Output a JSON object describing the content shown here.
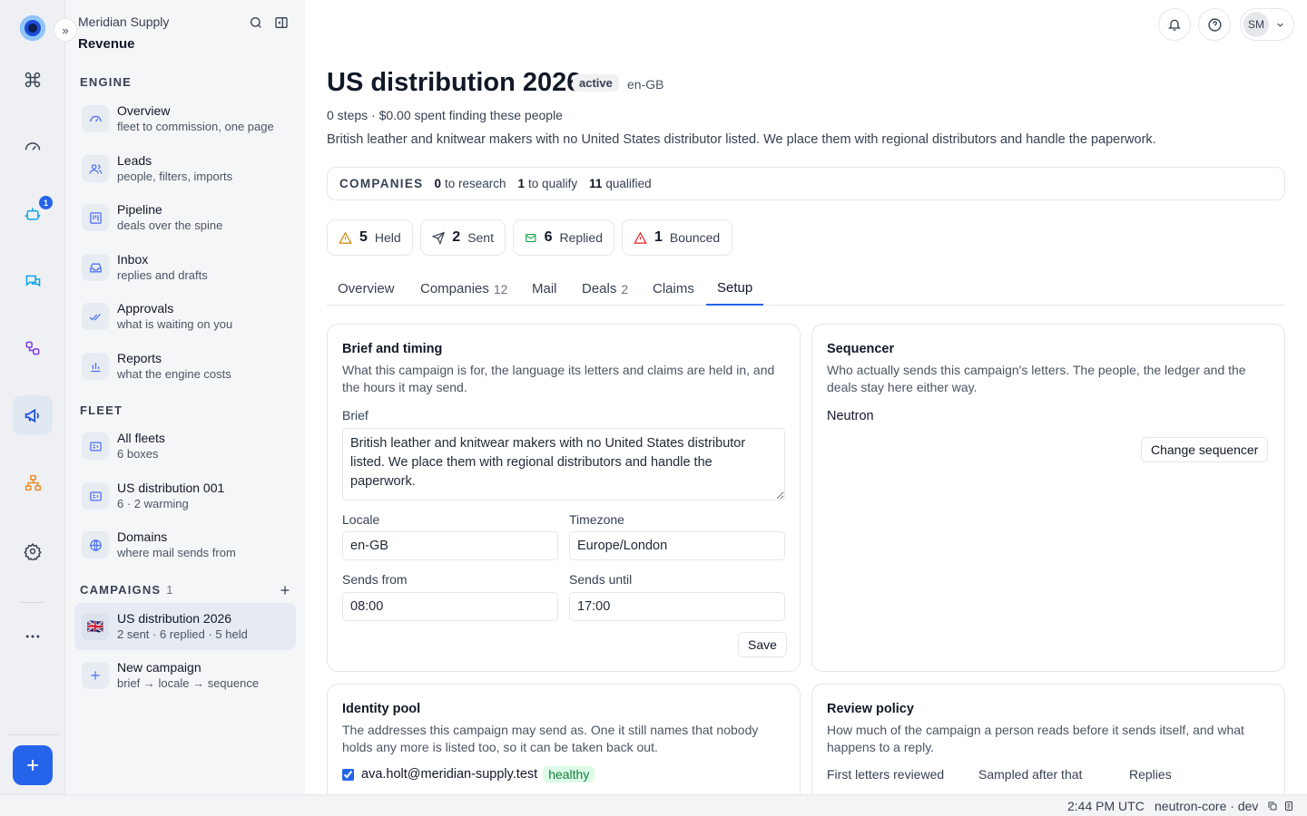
{
  "org": {
    "name": "Meridian Supply",
    "section": "Revenue"
  },
  "rail": {
    "badge_count": "1"
  },
  "sidebar": {
    "engine_title": "ENGINE",
    "engine": [
      {
        "label": "Overview",
        "sub": "fleet to commission, one page"
      },
      {
        "label": "Leads",
        "sub": "people, filters, imports"
      },
      {
        "label": "Pipeline",
        "sub": "deals over the spine"
      },
      {
        "label": "Inbox",
        "sub": "replies and drafts"
      },
      {
        "label": "Approvals",
        "sub": "what is waiting on you"
      },
      {
        "label": "Reports",
        "sub": "what the engine costs"
      }
    ],
    "fleet_title": "FLEET",
    "fleet": [
      {
        "label": "All fleets",
        "sub": "6 boxes"
      },
      {
        "label": "US distribution 001",
        "sub": "6 · 2 warming"
      },
      {
        "label": "Domains",
        "sub": "where mail sends from"
      }
    ],
    "campaigns_title": "CAMPAIGNS",
    "campaigns_count": "1",
    "campaigns": [
      {
        "flag": "🇬🇧",
        "label": "US distribution 2026",
        "sub": "2 sent · 6 replied · 5 held"
      },
      {
        "label": "New campaign",
        "sub": "brief → locale → sequence"
      }
    ]
  },
  "header": {
    "avatar_initials": "SM"
  },
  "campaign": {
    "title": "US distribution 2026",
    "status": "active",
    "locale": "en-GB",
    "meta": "0 steps · $0.00 spent finding these people",
    "description": "British leather and knitwear makers with no United States distributor listed. We place them with regional distributors and handle the paperwork."
  },
  "companies": {
    "title": "COMPANIES",
    "items": [
      {
        "num": "0",
        "label": "to research"
      },
      {
        "num": "1",
        "label": "to qualify"
      },
      {
        "num": "11",
        "label": "qualified"
      }
    ]
  },
  "stats": [
    {
      "num": "5",
      "label": "Held",
      "icon": "warning-icon"
    },
    {
      "num": "2",
      "label": "Sent",
      "icon": "send-icon"
    },
    {
      "num": "6",
      "label": "Replied",
      "icon": "mail-icon"
    },
    {
      "num": "1",
      "label": "Bounced",
      "icon": "warning-icon"
    }
  ],
  "tabs": [
    {
      "label": "Overview",
      "count": ""
    },
    {
      "label": "Companies",
      "count": "12"
    },
    {
      "label": "Mail",
      "count": ""
    },
    {
      "label": "Deals",
      "count": "2"
    },
    {
      "label": "Claims",
      "count": ""
    },
    {
      "label": "Setup",
      "count": ""
    }
  ],
  "brief_card": {
    "title": "Brief and timing",
    "desc": "What this campaign is for, the language its letters and claims are held in, and the hours it may send.",
    "brief_label": "Brief",
    "brief_value": "British leather and knitwear makers with no United States distributor listed. We place them with regional distributors and handle the paperwork.",
    "locale_label": "Locale",
    "locale_value": "en-GB",
    "timezone_label": "Timezone",
    "timezone_value": "Europe/London",
    "from_label": "Sends from",
    "from_value": "08:00",
    "until_label": "Sends until",
    "until_value": "17:00",
    "save_label": "Save"
  },
  "sequencer_card": {
    "title": "Sequencer",
    "desc": "Who actually sends this campaign's letters. The people, the ledger and the deals stay here either way.",
    "value": "Neutron",
    "change_label": "Change sequencer"
  },
  "identity_card": {
    "title": "Identity pool",
    "desc": "The addresses this campaign may send as. One it still names that nobody holds any more is listed too, so it can be taken back out.",
    "identities": [
      {
        "email": "ava.holt@meridian-supply.test",
        "status": "healthy",
        "checked": true
      }
    ]
  },
  "review_card": {
    "title": "Review policy",
    "desc": "How much of the campaign a person reads before it sends itself, and what happens to a reply.",
    "col1": "First letters reviewed",
    "col2": "Sampled after that",
    "col3": "Replies"
  },
  "statusbar": {
    "time": "2:44 PM UTC",
    "env": "neutron-core · dev"
  },
  "colors": {
    "accent": "#2563eb",
    "healthy_bg": "#dcfce7",
    "healthy_fg": "#15803d",
    "warning": "#dc2626"
  }
}
